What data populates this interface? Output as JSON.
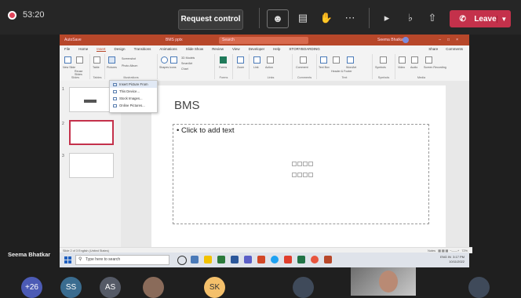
{
  "meeting": {
    "timer": "53:20",
    "request_control_label": "Request control",
    "leave_label": "Leave",
    "colors": {
      "leave": "#c4314b",
      "bar": "#262626"
    }
  },
  "ppt": {
    "title_autosave": "AutoSave",
    "title_doc": "BMS pptx",
    "search_placeholder": "Search",
    "user_name": "Seema Bhatkar",
    "tabs": [
      "File",
      "Home",
      "Insert",
      "Design",
      "Transitions",
      "Animations",
      "Slide Show",
      "Review",
      "View",
      "Developer",
      "Help",
      "STORYBOARDING"
    ],
    "active_tab": "Insert",
    "share_label": "Share",
    "comments_label": "Comments",
    "ribbon_groups": [
      "Slides",
      "Tables",
      "Illustrations",
      "Forms",
      "Links",
      "Comments",
      "Text",
      "Symbols",
      "Media"
    ],
    "ribbon_buttons": {
      "new_slide": "New Slide",
      "reuse_slides": "Reuse Slides",
      "table": "Table",
      "pictures": "Pictures",
      "screenshot": "Screenshot",
      "photo_album": "Photo Album",
      "shapes": "Shapes",
      "icons": "Icons",
      "models": "3D Models",
      "smartart": "SmartArt",
      "chart": "Chart",
      "forms": "Forms",
      "zoom": "Zoom",
      "link": "Link",
      "action": "Action",
      "comment": "Comment",
      "text_box": "Text Box",
      "header_footer": "Header & Footer",
      "wordart": "WordArt",
      "symbols": "Symbols",
      "video": "Video",
      "audio": "Audio",
      "screen_recording": "Screen Recording"
    },
    "insert_menu": [
      "Insert Picture From",
      "This Device...",
      "Stock Images...",
      "Online Pictures..."
    ],
    "slide_numbers": [
      "1",
      "2",
      "3"
    ],
    "slide_title": "BMS",
    "content_placeholder": "Click to add text",
    "status_left": "Slide 2 of 3   English (United States)",
    "status_notes": "Notes",
    "status_zoom": "72%",
    "taskbar_search": "Type here to search",
    "tray_time": "3:17 PM",
    "tray_date": "10/11/2022",
    "tray_lang": "ENG IN"
  },
  "presenter_name": "Seema Bhatkar",
  "participants": [
    {
      "label": "+26",
      "color": "#4c5bb5"
    },
    {
      "label": "SS",
      "color": "#3a6c8f"
    },
    {
      "label": "AS",
      "color": "#555a66"
    },
    {
      "label": "SK",
      "color": "#f4c06b"
    }
  ]
}
